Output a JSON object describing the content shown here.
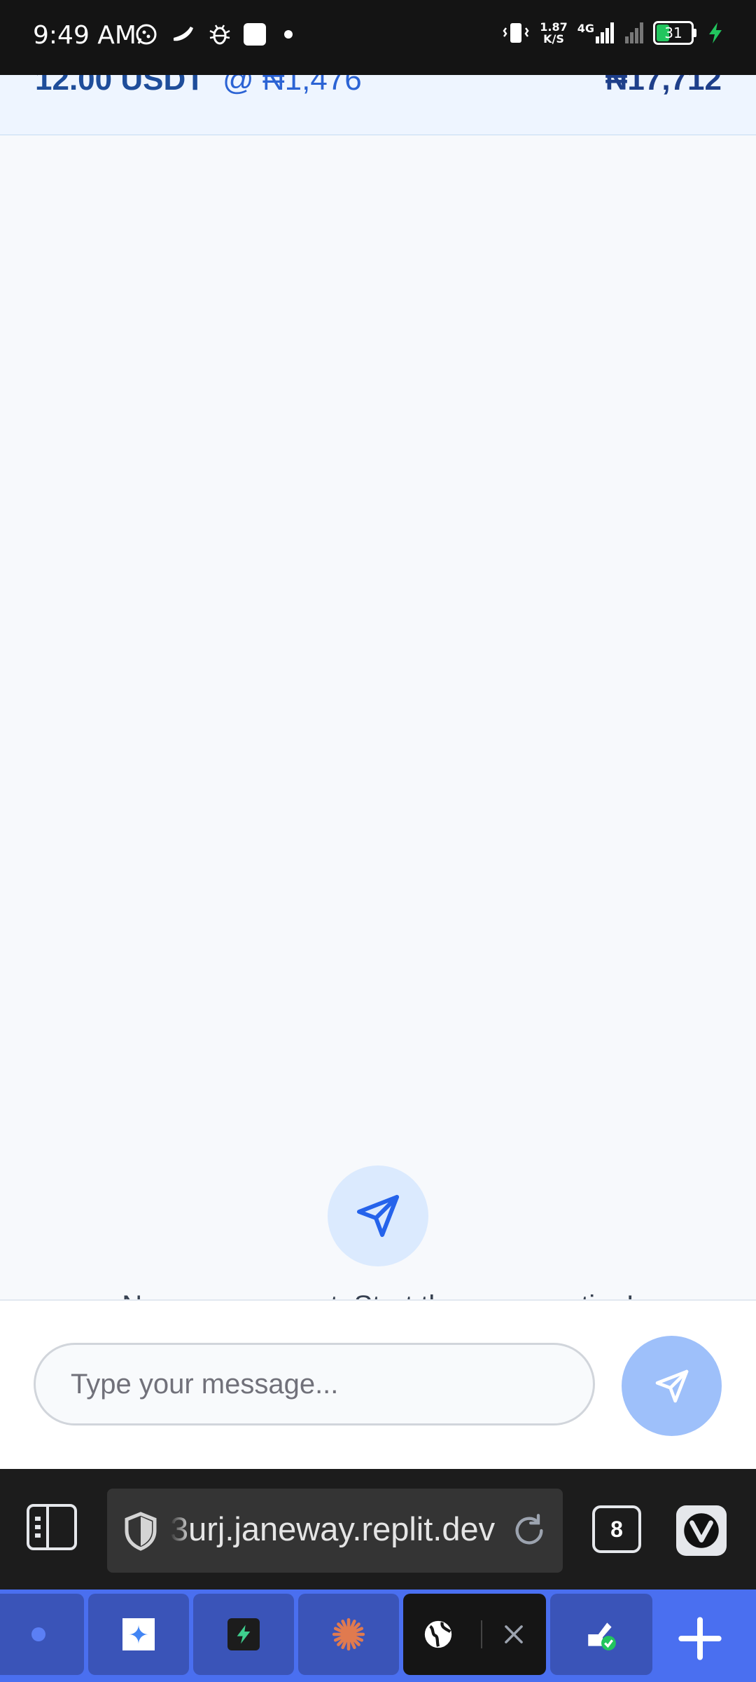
{
  "status_bar": {
    "time": "9:49 AM",
    "net_speed_value": "1.87",
    "net_speed_unit": "K/S",
    "network_type": "4G",
    "battery_level": "31",
    "icons": [
      "whatsapp-icon",
      "chili-icon",
      "bug-icon",
      "app-icon",
      "dot-icon",
      "vibrate-icon",
      "signal-icon",
      "battery-icon",
      "charging-icon"
    ]
  },
  "order_summary": {
    "amount": "12.00 USDT",
    "rate": "@ ₦1,476",
    "total": "₦17,712"
  },
  "chat": {
    "empty_message": "No messages yet. Start the conversation!",
    "input_placeholder": "Type your message..."
  },
  "browser": {
    "url": "3urj.janeway.replit.dev",
    "tab_count": "8"
  },
  "colors": {
    "accent_blue": "#2563eb",
    "send_button_disabled": "#9ec0fa",
    "tab_bar": "#4a6ff0"
  }
}
